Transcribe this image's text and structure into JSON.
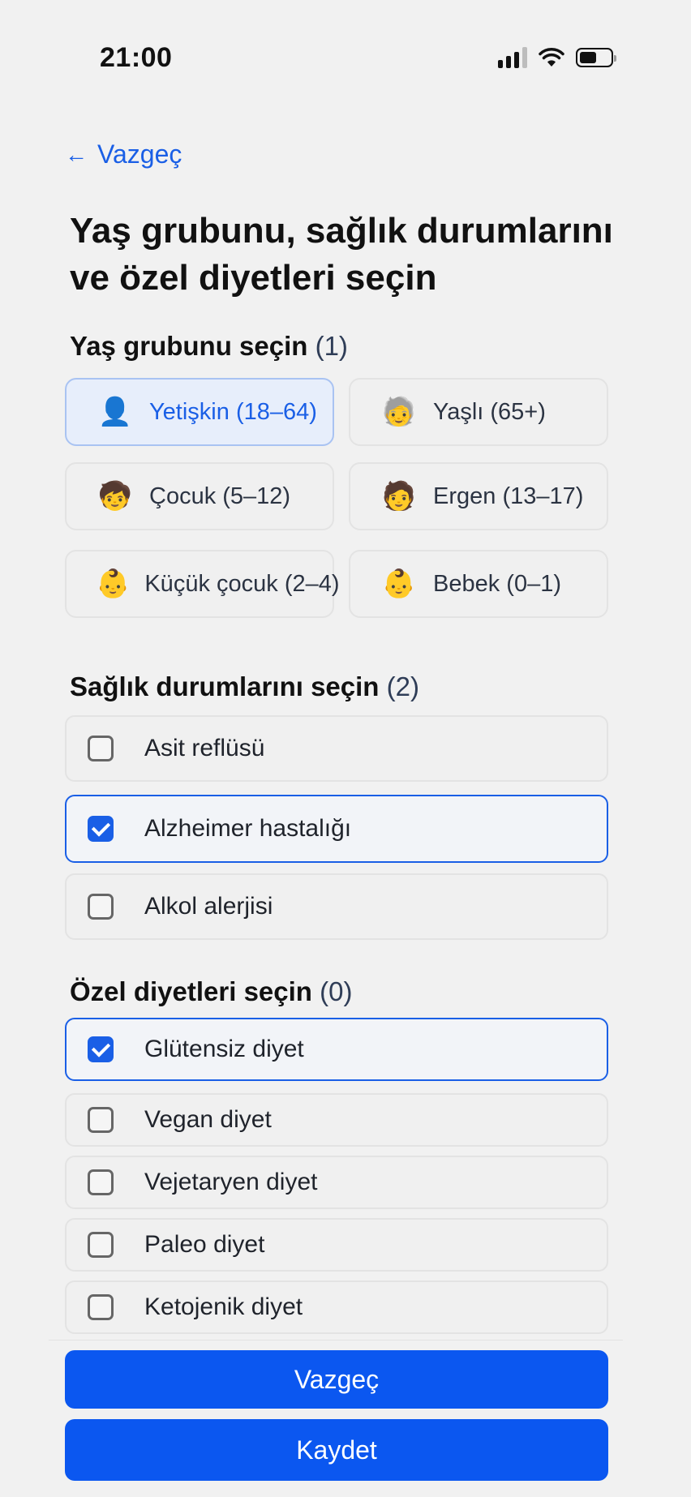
{
  "status_bar": {
    "time": "21:00",
    "icons": [
      "signal-icon",
      "wifi-icon",
      "battery-icon"
    ]
  },
  "back_link": {
    "label": "Vazgeç",
    "icon": "arrow-left-icon"
  },
  "page_title": "Yaş grubunu, sağlık durumlarını ve özel diyetleri seçin",
  "age_section": {
    "title": "Yaş grubunu seçin",
    "count": "(1)",
    "items": [
      {
        "label": "Yetişkin (18–64)",
        "icon": "👤",
        "icon_name": "adult-silhouette-icon",
        "selected": true
      },
      {
        "label": "Yaşlı (65+)",
        "icon": "🧓",
        "icon_name": "older-person-icon",
        "selected": false
      },
      {
        "label": "Çocuk (5–12)",
        "icon": "🧒",
        "icon_name": "child-icon",
        "selected": false
      },
      {
        "label": "Ergen (13–17)",
        "icon": "🧑",
        "icon_name": "teen-icon",
        "selected": false
      },
      {
        "label": "Küçük çocuk (2–4)",
        "icon": "👶",
        "icon_name": "toddler-icon",
        "selected": false
      },
      {
        "label": "Bebek (0–1)",
        "icon": "👶",
        "icon_name": "baby-icon",
        "selected": false
      }
    ]
  },
  "health_section": {
    "title": "Sağlık durumlarını seçin",
    "count": "(2)",
    "items": [
      {
        "label": "Asit reflüsü",
        "checked": false
      },
      {
        "label": "Alzheimer hastalığı",
        "checked": true
      },
      {
        "label": "Alkol alerjisi",
        "checked": false
      }
    ]
  },
  "diet_section": {
    "title": "Özel diyetleri seçin",
    "count": "(0)",
    "items": [
      {
        "label": "Glütensiz diyet",
        "checked": true
      },
      {
        "label": "Vegan diyet",
        "checked": false
      },
      {
        "label": "Vejetaryen diyet",
        "checked": false
      },
      {
        "label": "Paleo diyet",
        "checked": false
      },
      {
        "label": "Ketojenik diyet",
        "checked": false
      }
    ]
  },
  "buttons": {
    "cancel_label": "Vazgeç",
    "save_label": "Kaydet"
  },
  "colors": {
    "accent": "#0b57f0",
    "link": "#1a5fe6",
    "background": "#f1f1f1",
    "selected_card_bg": "#e7eefb"
  }
}
